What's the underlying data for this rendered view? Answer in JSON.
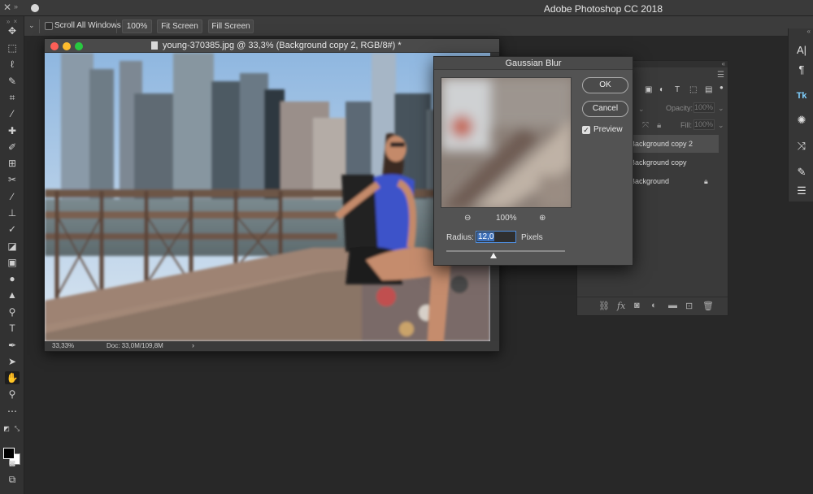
{
  "app": {
    "title": "Adobe Photoshop CC 2018"
  },
  "options_bar": {
    "scroll_all_windows": "Scroll All Windows",
    "zoom_button": "100%",
    "fit_screen": "Fit Screen",
    "fill_screen": "Fill Screen"
  },
  "toolbar": {
    "tools": [
      "move-icon",
      "marquee-icon",
      "lasso-icon",
      "quick-select-icon",
      "crop-icon",
      "eyedropper-icon",
      "healing-icon",
      "brush-icon",
      "clone-stamp-icon",
      "history-brush-icon",
      "eraser-icon",
      "gradient-icon",
      "blur-icon",
      "dodge-icon",
      "pen-icon",
      "type-icon",
      "path-select-icon",
      "rectangle-icon",
      "hand-icon",
      "zoom-icon",
      "more-icon"
    ],
    "active_tool": "hand-icon",
    "foreground_color": "#000000",
    "background_color": "#ffffff"
  },
  "document": {
    "title": "young-370385.jpg @ 33,3% (Background copy 2, RGB/8#) *",
    "zoom": "33,33%",
    "doc_size": "Doc: 33,0M/109,8M"
  },
  "dialog": {
    "title": "Gaussian Blur",
    "ok": "OK",
    "cancel": "Cancel",
    "preview_label": "Preview",
    "preview_checked": true,
    "zoom": "100%",
    "radius_label": "Radius:",
    "radius_value": "12,0",
    "radius_units": "Pixels"
  },
  "layers_panel": {
    "opacity_label": "Opacity:",
    "opacity_value": "100%",
    "fill_label": "Fill:",
    "fill_value": "100%",
    "layers": [
      {
        "name": "Background copy 2",
        "selected": true
      },
      {
        "name": "Background copy",
        "selected": false
      },
      {
        "name": "Background",
        "selected": false,
        "locked": true
      }
    ]
  },
  "colors": {
    "app_bg": "#282828",
    "panel_bg": "#3a3a3a",
    "dialog_bg": "#535353",
    "accent": "#4f8ede",
    "traffic_red": "#fc5f57",
    "traffic_yellow": "#fdbc2e",
    "traffic_green": "#28c840"
  }
}
